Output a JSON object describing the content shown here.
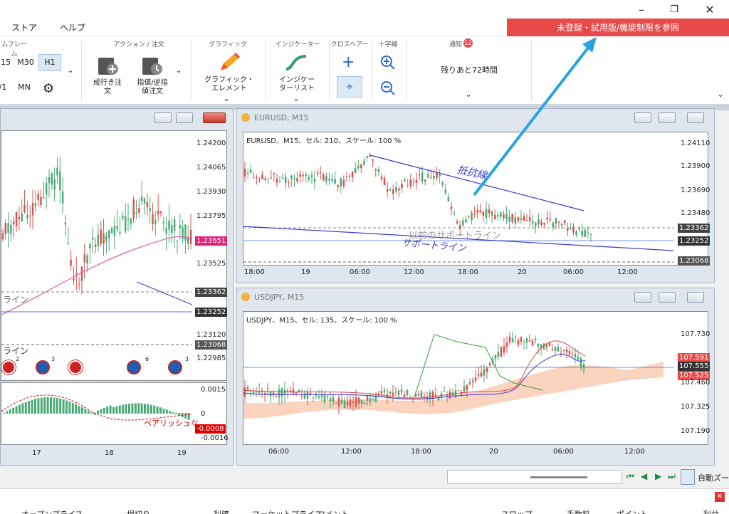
{
  "menu": {
    "items": [
      "ストア",
      "ヘルプ"
    ]
  },
  "trial_banner": "未登録・試用版/機能制限を参照",
  "ribbon": {
    "timeframe": {
      "title": "ムフレーム",
      "buttons": [
        "15",
        "M30",
        "H1",
        "/1",
        "MN"
      ]
    },
    "actions": {
      "title": "アクション / 注文",
      "market_order": "成行き注\n文",
      "limit_order": "指値/逆指\n値注文"
    },
    "graphics": {
      "title": "グラフィック",
      "label": "グラフィック・\nエレメント"
    },
    "indicators": {
      "title": "インジケーター",
      "label": "インジケー\nターリスト"
    },
    "crosshair": {
      "title": "クロスヘアー"
    },
    "crosshair2": {
      "title": "十字線"
    },
    "notify": {
      "title": "通知",
      "badge": "12",
      "remaining": "残りあと72時間"
    }
  },
  "left_chart": {
    "y_labels": [
      "1.24200",
      "1.24065",
      "1.23930",
      "1.23795",
      "1.23525",
      "1.23120",
      "1.22985"
    ],
    "price_tags": {
      "current": "1.23651",
      "line1": "1.23362",
      "line2": "1.23252",
      "line3": "1.23068"
    },
    "line_labels": [
      "ライン",
      "ライン"
    ],
    "event_counts": [
      "2",
      "3",
      "6",
      "3"
    ],
    "osc_labels": [
      "0.0015",
      "0",
      "-0.0016"
    ],
    "osc_tag": "-0.0008",
    "bearish": "ベアリッシュな",
    "x_labels": [
      "17",
      "18",
      "19"
    ]
  },
  "eurusd": {
    "title": "EURUSD, M15",
    "info": "EURUSD、M15、セル: 210、スケール: 100 %",
    "y_labels": [
      "1.24110",
      "1.23900",
      "1.23690",
      "1.23480"
    ],
    "price_tags": {
      "t1": "1.23362",
      "t2": "1.23252",
      "t3": "1.23068"
    },
    "resistance": "抵抗線",
    "support": "サポートライン",
    "past_support": "以前のサポートライン",
    "x_labels": [
      "18:00",
      "19",
      "06:00",
      "12:00",
      "18:00",
      "20",
      "06:00",
      "12:00"
    ]
  },
  "usdjpy": {
    "title": "USDJPY, M15",
    "info": "USDJPY、M15、セル: 135、スケール: 100 %",
    "y_labels": [
      "107.730",
      "107.460",
      "107.325",
      "107.190"
    ],
    "price_tags": {
      "t1": "107.591",
      "t2": "107.555",
      "t3": "107.525"
    },
    "x_labels": [
      "06:00",
      "12:00",
      "18:00",
      "20",
      "06:00",
      "12:00"
    ]
  },
  "status": {
    "auto_scroll": "自動ズー"
  },
  "table_columns": [
    "オープンプライス",
    "損切り",
    "利確",
    "マーケットプライス",
    "コメント",
    "スワップ",
    "手数料",
    "ポイント",
    "利益"
  ],
  "colors": {
    "bull": "#4aaa78",
    "bear": "#d9534f",
    "blue_line": "#3a3ad0",
    "accent_red": "#e84a4a",
    "arrow": "#29a3e0"
  }
}
